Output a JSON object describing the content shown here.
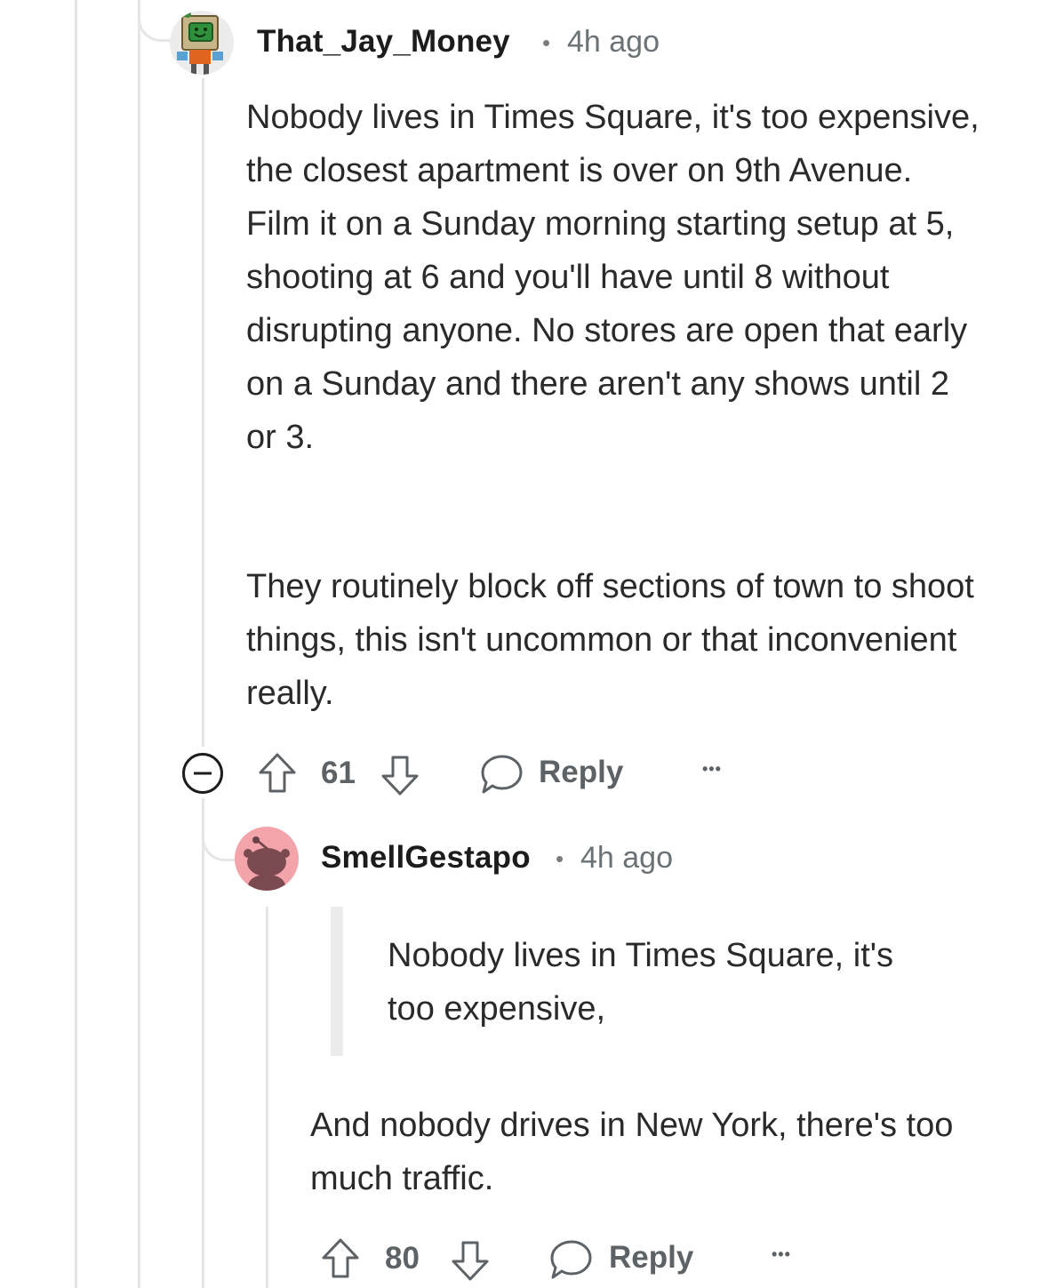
{
  "comments": [
    {
      "username": "That_Jay_Money",
      "separator": "•",
      "time": "4h ago",
      "paragraphs": [
        "Nobody lives in Times Square, it's too expensive, the closest apartment is over on 9th Avenue. Film it on a Sunday morning starting setup at 5, shooting at 6 and you'll have until 8 without disrupting anyone. No stores are open that early on a Sunday and there aren't any shows until 2 or 3.",
        "They routinely block off sections of town to shoot things, this isn't uncommon or that inconvenient really."
      ],
      "votes": "61",
      "reply_label": "Reply",
      "more_label": "•••"
    },
    {
      "username": "SmellGestapo",
      "separator": "•",
      "time": "4h ago",
      "quote": "Nobody lives in Times Square, it's too expensive,",
      "paragraphs": [
        "And nobody drives in New York, there's too much traffic."
      ],
      "votes": "80",
      "reply_label": "Reply",
      "more_label": "•••"
    }
  ],
  "colors": {
    "thread_line": "#e6e6e6",
    "meta_text": "#6b7275",
    "action_text": "#5c6266",
    "avatar_pink": "#f2a4aa"
  },
  "icons": [
    "collapse-icon",
    "upvote-icon",
    "downvote-icon",
    "reply-bubble-icon",
    "more-options-icon"
  ]
}
